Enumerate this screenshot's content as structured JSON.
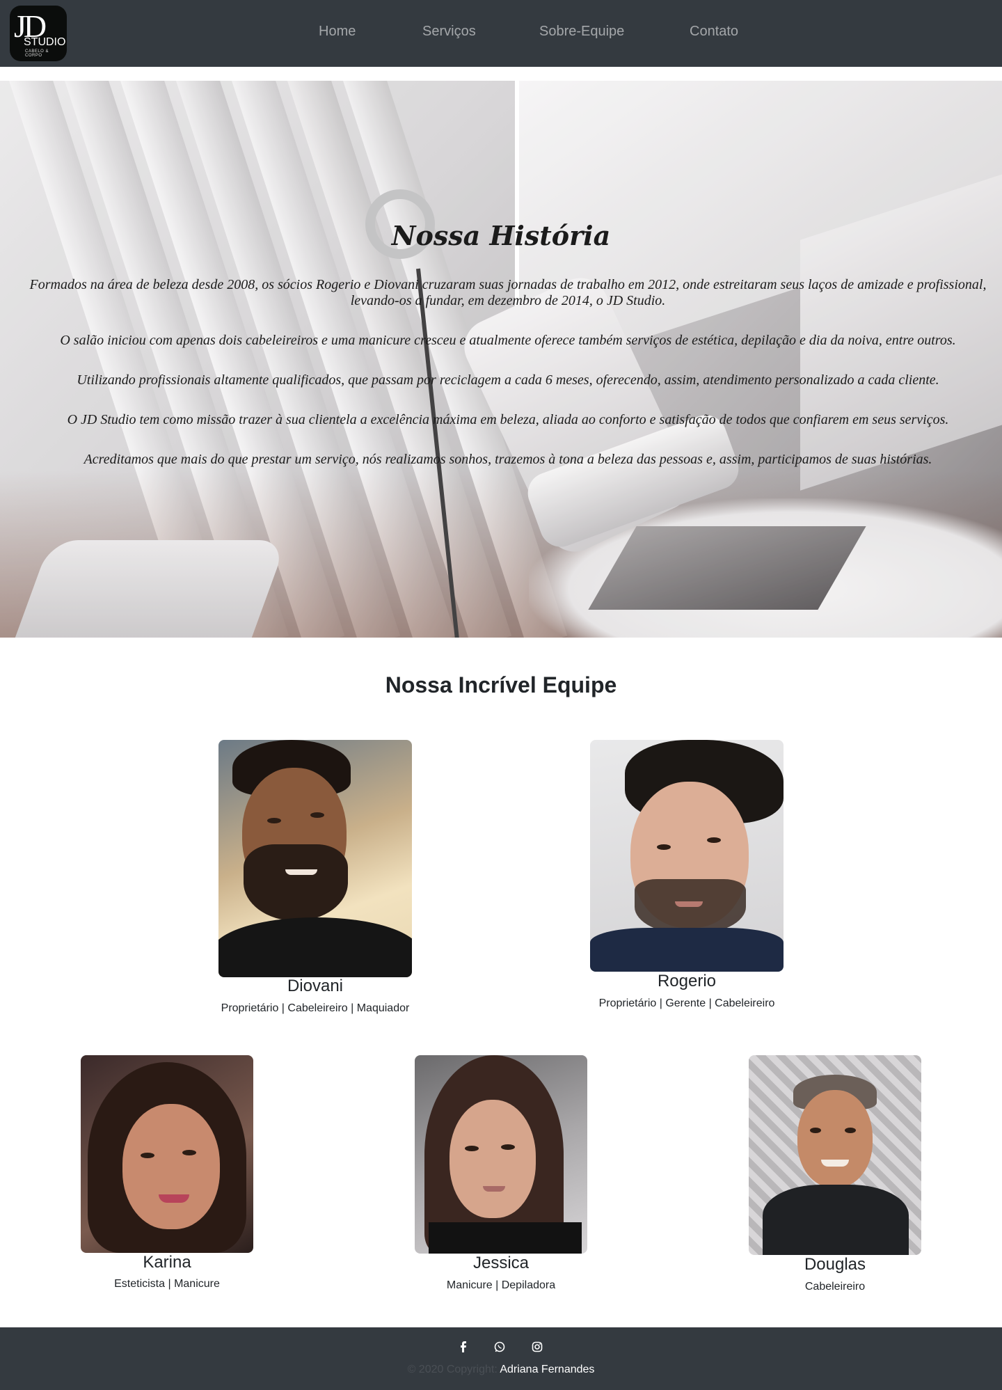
{
  "brand": {
    "logo_main": "JD",
    "logo_word": "STUDIO",
    "logo_sub": "CABELO & CORPO"
  },
  "nav": {
    "items": [
      "Home",
      "Serviços",
      "Sobre-Equipe",
      "Contato"
    ]
  },
  "history": {
    "title": "Nossa História",
    "paragraphs": [
      "Formados na área de beleza desde 2008, os sócios Rogerio e Diovani cruzaram suas jornadas de trabalho em 2012, onde estreitaram seus laços de amizade e profissional, levando-os a fundar, em dezembro de 2014, o JD Studio.",
      "O salão iniciou com apenas dois cabeleireiros e uma manicure cresceu e atualmente oferece também serviços de estética, depilação e dia da noiva, entre outros.",
      "Utilizando profissionais altamente qualificados, que passam por reciclagem a cada 6 meses, oferecendo, assim, atendimento personalizado a cada cliente.",
      "O JD Studio tem como missão trazer à sua clientela a excelência máxima em beleza, aliada ao conforto e satisfação de todos que confiarem em seus serviços.",
      "Acreditamos que mais do que prestar um serviço, nós realizamos sonhos, trazemos à tona a beleza das pessoas e, assim, participamos de suas histórias."
    ]
  },
  "team": {
    "title": "Nossa Incrível Equipe",
    "members": [
      {
        "name": "Diovani",
        "role": "Proprietário | Cabeleireiro | Maquiador"
      },
      {
        "name": "Rogerio",
        "role": "Proprietário | Gerente | Cabeleireiro"
      },
      {
        "name": "Karina",
        "role": "Esteticista | Manicure"
      },
      {
        "name": "Jessica",
        "role": "Manicure | Depiladora"
      },
      {
        "name": "Douglas",
        "role": "Cabeleireiro"
      }
    ]
  },
  "footer": {
    "social_icons": [
      "facebook-icon",
      "whatsapp-icon",
      "instagram-icon"
    ],
    "copyright_prefix": "© 2020 Copyright:",
    "copyright_name": "Adriana Fernandes"
  },
  "colors": {
    "navbar": "#343a40",
    "nav_link": "rgba(255,255,255,0.55)",
    "footer": "#343a40"
  }
}
